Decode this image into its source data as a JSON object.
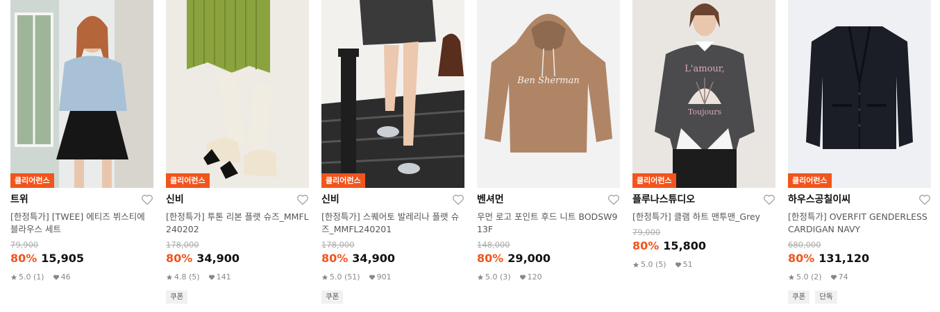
{
  "products": [
    {
      "badge": "클리어런스",
      "brand": "트위",
      "name": "[한정특가] [TWEE] 에티즈 뷔스티에 블라우스 세트",
      "original_price": "79,900",
      "discount": "80%",
      "price": "15,905",
      "rating": "5.0 (1)",
      "likes": "46",
      "tags": [],
      "image": "model-blue-blouse-black-skirt"
    },
    {
      "badge": "클리어런스",
      "brand": "신비",
      "name": "[한정특가] 투톤 리본 플랫 슈즈_MMFL240202",
      "original_price": "178,000",
      "discount": "80%",
      "price": "34,900",
      "rating": "4.8 (5)",
      "likes": "141",
      "tags": [
        "쿠폰"
      ],
      "image": "two-tone-ribbon-flat-shoes"
    },
    {
      "badge": "클리어런스",
      "brand": "신비",
      "name": "[한정특가] 스퀘어토 발레리나 플랫 슈즈_MMFL240201",
      "original_price": "178,000",
      "discount": "80%",
      "price": "34,900",
      "rating": "5.0 (51)",
      "likes": "901",
      "tags": [
        "쿠폰"
      ],
      "image": "square-toe-ballerina-flats"
    },
    {
      "badge": "",
      "brand": "벤셔먼",
      "name": "우먼 로고 포인트 후드 니트 BODSW913F",
      "original_price": "148,000",
      "discount": "80%",
      "price": "29,000",
      "rating": "5.0 (3)",
      "likes": "120",
      "tags": [],
      "image": "ben-sherman-hood-knit",
      "image_text": "Ben Sherman"
    },
    {
      "badge": "클리어런스",
      "brand": "플루나스튜디오",
      "name": "[한정특가] 클램 하트 맨투맨_Grey",
      "original_price": "79,000",
      "discount": "80%",
      "price": "15,800",
      "rating": "5.0 (5)",
      "likes": "51",
      "tags": [],
      "image": "clam-heart-sweatshirt-grey",
      "image_text": [
        "L'amour,",
        "Toujours"
      ]
    },
    {
      "badge": "클리어런스",
      "brand": "하우스공칠이씨",
      "name": "[한정특가] OVERFIT GENDERLESS CARDIGAN NAVY",
      "original_price": "680,000",
      "discount": "80%",
      "price": "131,120",
      "rating": "5.0 (2)",
      "likes": "74",
      "tags": [
        "쿠폰",
        "단독"
      ],
      "image": "navy-overfit-cardigan"
    }
  ],
  "colors": {
    "accent": "#f2541c",
    "badge_text": "#ffffff"
  }
}
